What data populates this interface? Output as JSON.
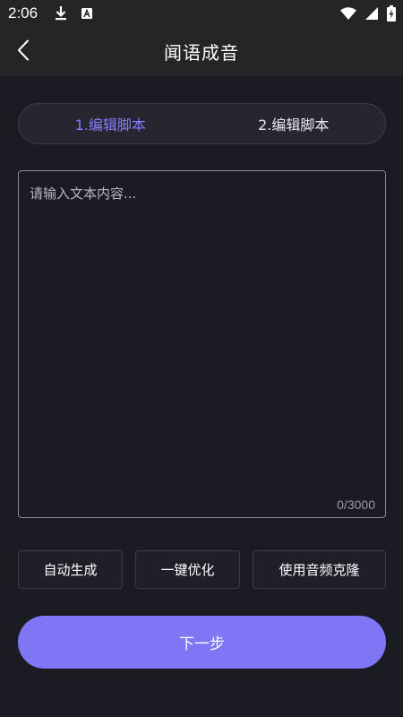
{
  "status_bar": {
    "time": "2:06",
    "icons": [
      "download-icon",
      "a-notification-icon",
      "wifi-icon",
      "signal-icon",
      "battery-charging-icon"
    ]
  },
  "app_bar": {
    "title": "闻语成音",
    "back_icon": "chevron-left-icon"
  },
  "tabs": [
    {
      "label": "1.编辑脚本",
      "active": true
    },
    {
      "label": "2.编辑脚本",
      "active": false
    }
  ],
  "editor": {
    "placeholder": "请输入文本内容...",
    "value": "",
    "char_count": "0/3000"
  },
  "actions": {
    "auto_generate": "自动生成",
    "one_click_optimize": "一键优化",
    "use_audio_clone": "使用音频克隆"
  },
  "next_button": "下一步",
  "colors": {
    "background": "#1b1b24",
    "bar_background": "#252527",
    "accent": "#7f76f5",
    "active_tab": "#8a7bff"
  }
}
